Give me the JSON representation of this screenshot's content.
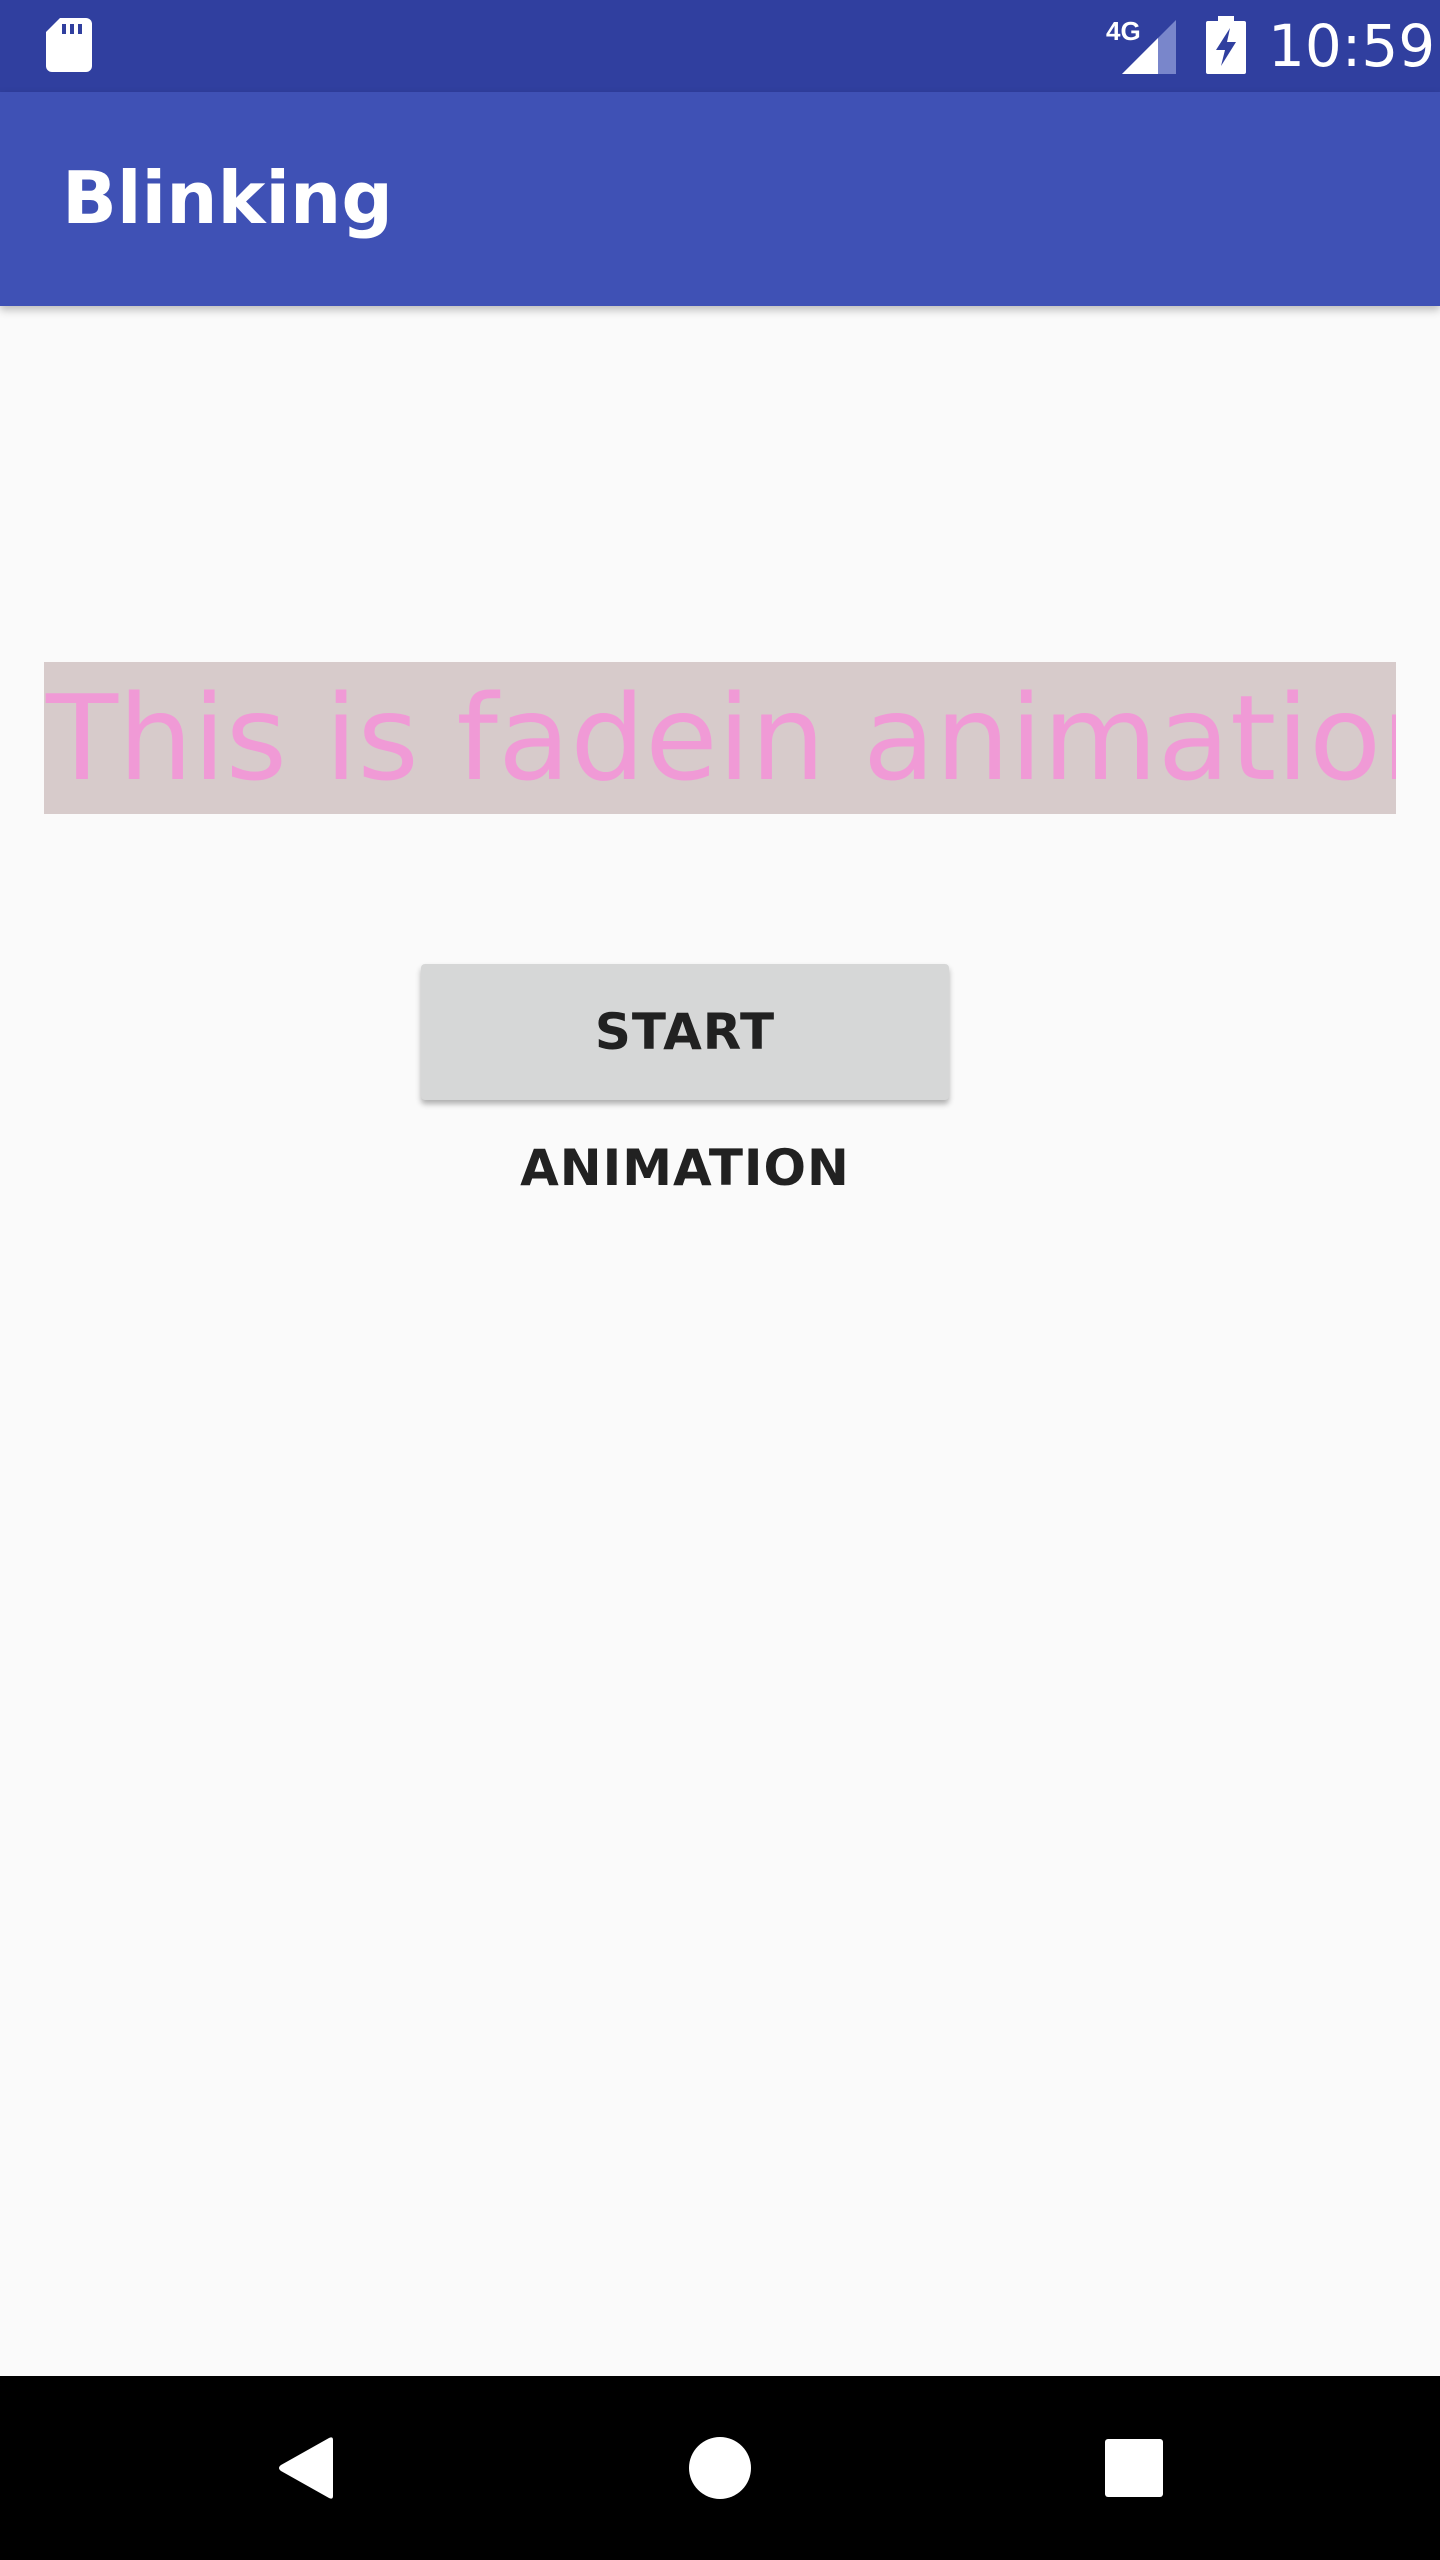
{
  "status_bar": {
    "network": "4G",
    "time": "10:59",
    "icons": [
      "sd-card-icon",
      "signal-icon",
      "battery-charging-icon"
    ]
  },
  "app_bar": {
    "title": "Blinking"
  },
  "content": {
    "fade_text": "This is fadein animation",
    "start_button_label": "START ANIMATION"
  },
  "nav_bar": {
    "icons": [
      "back-icon",
      "home-icon",
      "recents-icon"
    ]
  },
  "colors": {
    "status_bar": "#303f9f",
    "app_bar": "#3f51b5",
    "background": "#fafafa",
    "fade_text": "#f09ad6",
    "fade_text_bg": "#d7cbcb",
    "button_bg": "#d6d7d7",
    "nav_bar": "#000000"
  }
}
